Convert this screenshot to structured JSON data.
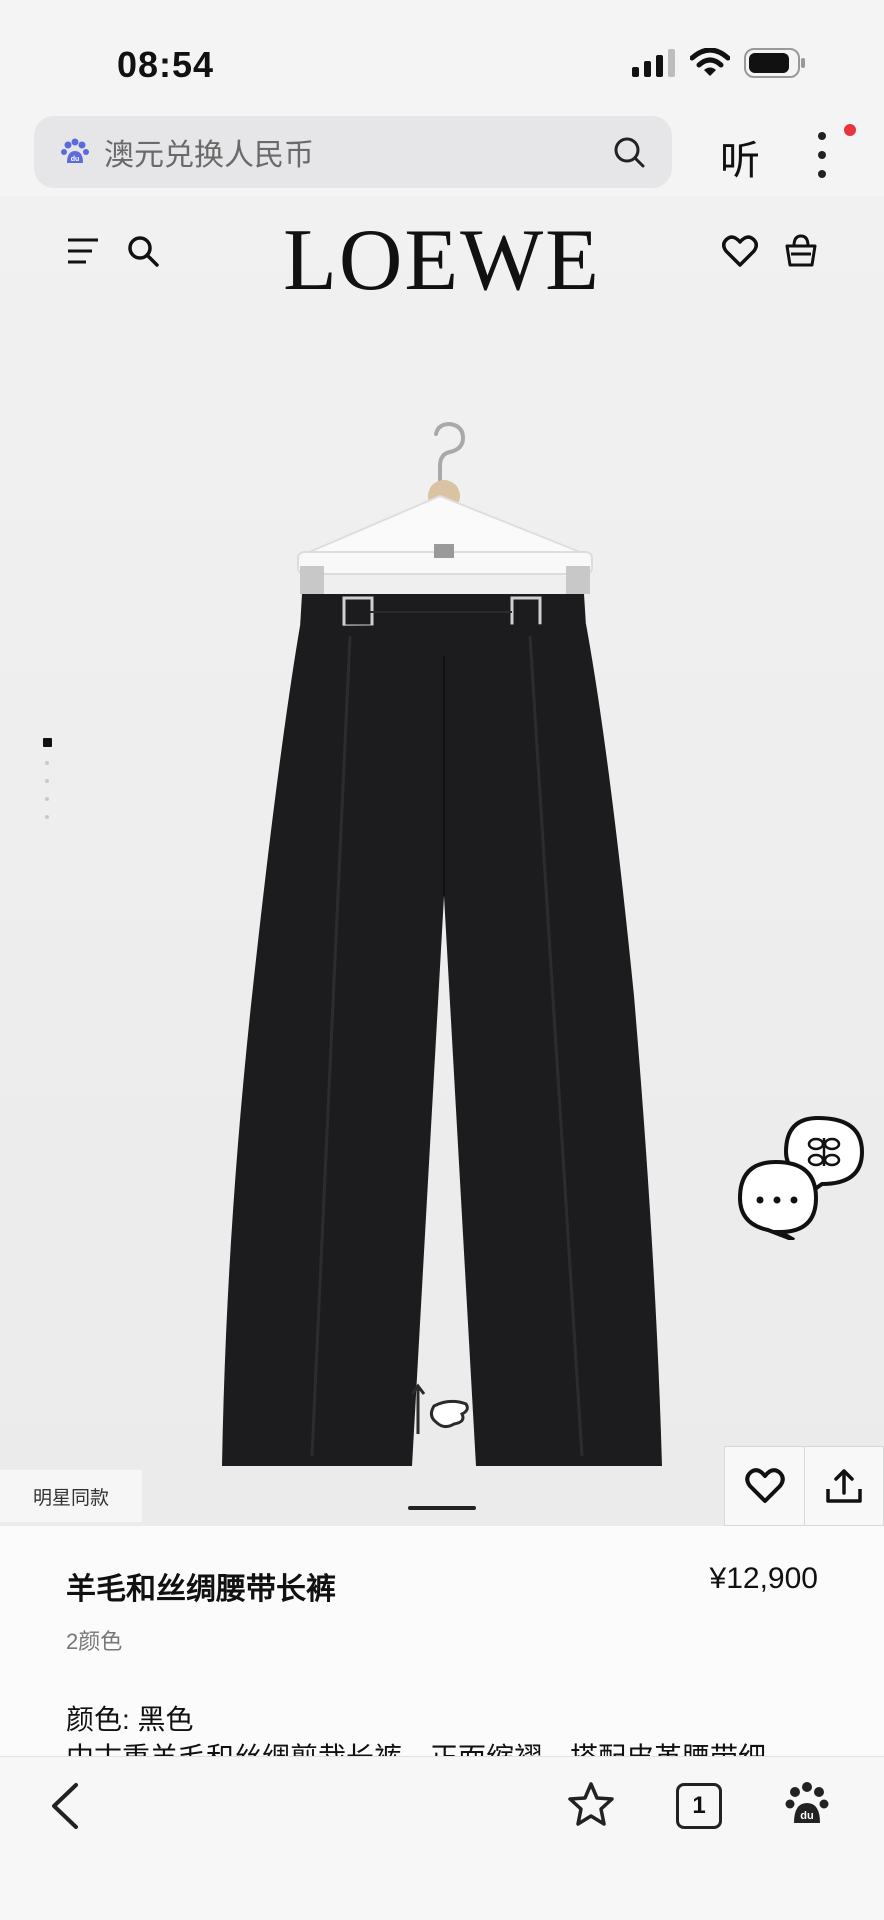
{
  "status_bar": {
    "time": "08:54"
  },
  "browser": {
    "search_query": "澳元兑换人民币",
    "listen_label": "听",
    "tab_count": "1"
  },
  "site": {
    "logo": "LOEWE"
  },
  "product": {
    "badge": "明星同款",
    "name": "羊毛和丝绸腰带长裤",
    "price": "¥12,900",
    "color_count": "2颜色",
    "color_line": "颜色: 黑色",
    "description": "中古重羊毛和丝绸剪裁长裤，正面缩褶，搭配皮革腰带细"
  },
  "gallery": {
    "image_count": 5,
    "active_index": 1
  },
  "colors": {
    "product": "#1c1c1e",
    "accent_dot": "#e8343f",
    "baidu": "#5b6bdc"
  }
}
